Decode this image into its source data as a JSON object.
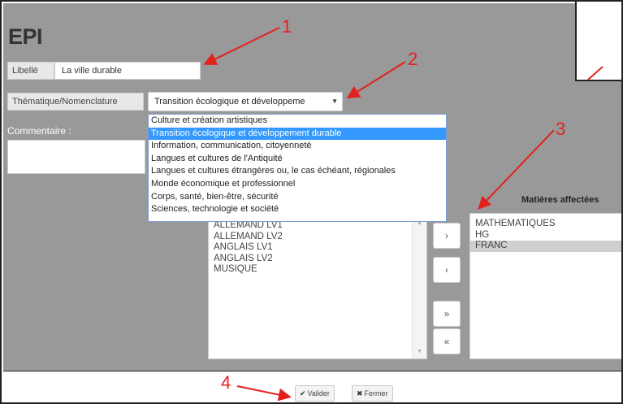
{
  "window": {
    "title": "EPI"
  },
  "form": {
    "libelle_label": "Libellé",
    "libelle_value": "La ville durable",
    "thematique_label": "Thématique/Nomenclature",
    "thematique_selected": "Transition écologique et développeme",
    "commentaire_label": "Commentaire :"
  },
  "dropdown": {
    "options": [
      "Culture et création artistiques",
      "Transition écologique et développement durable",
      "Information, communication, citoyenneté",
      "Langues et cultures de l'Antiquité",
      "Langues et cultures étrangères ou, le cas échéant, régionales",
      "Monde économique et professionnel",
      "Corps, santé, bien-être, sécurité",
      "Sciences, technologie et société"
    ],
    "selected_index": 1
  },
  "available_subjects": [
    "ALLEMAND LV1",
    "ALLEMAND LV2",
    "ANGLAIS LV1",
    "ANGLAIS LV2",
    "MUSIQUE"
  ],
  "assigned": {
    "heading": "Matières affectées",
    "items": [
      "MATHEMATIQUES",
      "HG",
      "FRANC"
    ],
    "highlighted_index": 2
  },
  "move_buttons": {
    "add": "›",
    "remove": "‹",
    "add_all": "»",
    "remove_all": "«"
  },
  "footer": {
    "validate_label": "Valider",
    "close_label": "Fermer"
  },
  "annotations": [
    "1",
    "2",
    "3",
    "4"
  ],
  "colors": {
    "panel_bg": "#999999",
    "selection": "#3399ff",
    "annotation": "#e3211c"
  }
}
